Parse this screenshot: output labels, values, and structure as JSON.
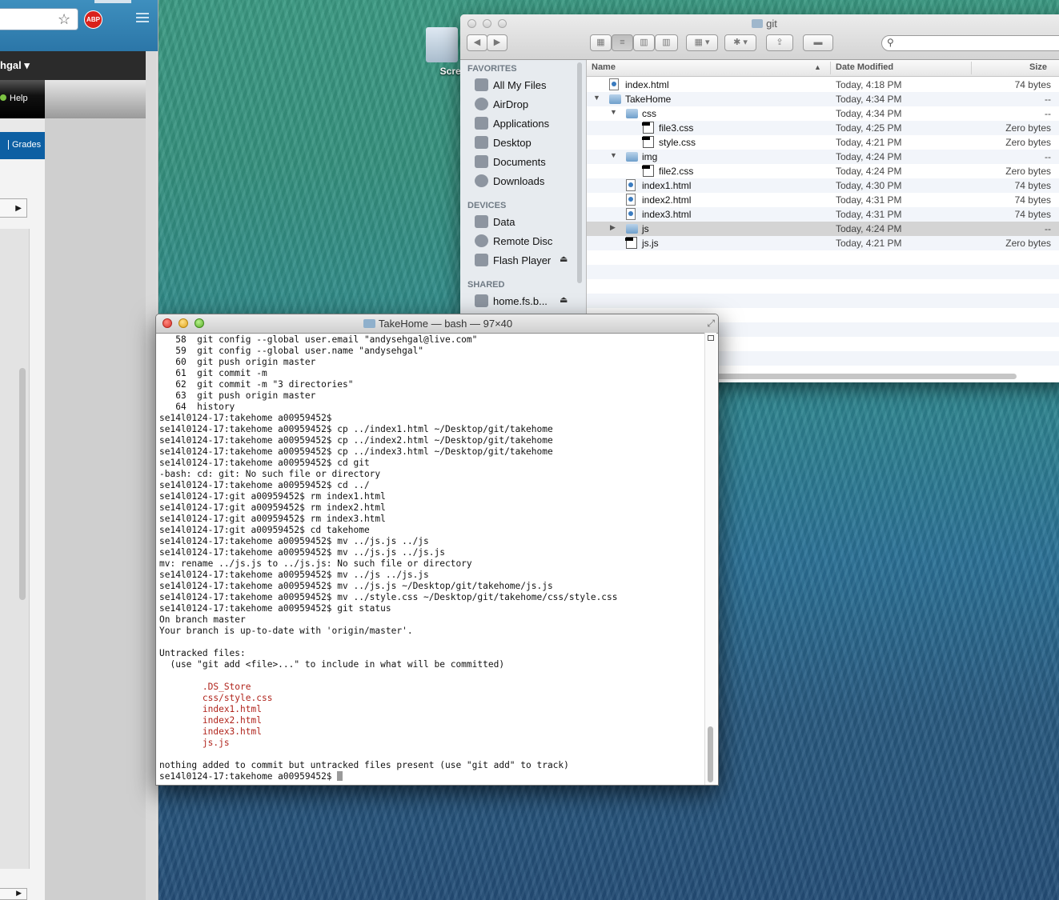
{
  "browser": {
    "user_label": "hgal ▾",
    "help_label": "Help",
    "nav_label": "Grades",
    "abp_label": "ABP",
    "arrow": "▶"
  },
  "desktop": {
    "icon_label": "Screens"
  },
  "finder": {
    "title": "git",
    "search_placeholder": "",
    "sidebar": {
      "favorites_header": "FAVORITES",
      "devices_header": "DEVICES",
      "shared_header": "SHARED",
      "favorites": [
        "All My Files",
        "AirDrop",
        "Applications",
        "Desktop",
        "Documents",
        "Downloads"
      ],
      "devices": [
        "Data",
        "Remote Disc",
        "Flash Player"
      ],
      "shared": [
        "home.fs.b..."
      ]
    },
    "columns": {
      "name": "Name",
      "date": "Date Modified",
      "size": "Size",
      "sort_arrow": "▲"
    },
    "rows": [
      {
        "name": "index.html",
        "date": "Today, 4:18 PM",
        "size": "74 bytes",
        "kind": "html",
        "depth": 0,
        "disc": ""
      },
      {
        "name": "TakeHome",
        "date": "Today, 4:34 PM",
        "size": "--",
        "kind": "folder",
        "depth": 0,
        "disc": "▼"
      },
      {
        "name": "css",
        "date": "Today, 4:34 PM",
        "size": "--",
        "kind": "folder",
        "depth": 1,
        "disc": "▼"
      },
      {
        "name": "file3.css",
        "date": "Today, 4:25 PM",
        "size": "Zero bytes",
        "kind": "css",
        "depth": 2,
        "disc": ""
      },
      {
        "name": "style.css",
        "date": "Today, 4:21 PM",
        "size": "Zero bytes",
        "kind": "css",
        "depth": 2,
        "disc": ""
      },
      {
        "name": "img",
        "date": "Today, 4:24 PM",
        "size": "--",
        "kind": "folder",
        "depth": 1,
        "disc": "▼"
      },
      {
        "name": "file2.css",
        "date": "Today, 4:24 PM",
        "size": "Zero bytes",
        "kind": "css",
        "depth": 2,
        "disc": ""
      },
      {
        "name": "index1.html",
        "date": "Today, 4:30 PM",
        "size": "74 bytes",
        "kind": "html",
        "depth": 1,
        "disc": ""
      },
      {
        "name": "index2.html",
        "date": "Today, 4:31 PM",
        "size": "74 bytes",
        "kind": "html",
        "depth": 1,
        "disc": ""
      },
      {
        "name": "index3.html",
        "date": "Today, 4:31 PM",
        "size": "74 bytes",
        "kind": "html",
        "depth": 1,
        "disc": ""
      },
      {
        "name": "js",
        "date": "Today, 4:24 PM",
        "size": "--",
        "kind": "folder",
        "depth": 1,
        "disc": "▶",
        "selected": true
      },
      {
        "name": "js.js",
        "date": "Today, 4:21 PM",
        "size": "Zero bytes",
        "kind": "css",
        "depth": 1,
        "disc": ""
      }
    ]
  },
  "terminal": {
    "title": "TakeHome — bash — 97×40",
    "lines": [
      {
        "text": "   58  git config --global user.email \"andysehgal@live.com\""
      },
      {
        "text": "   59  git config --global user.name \"andysehgal\""
      },
      {
        "text": "   60  git push origin master"
      },
      {
        "text": "   61  git commit -m"
      },
      {
        "text": "   62  git commit -m \"3 directories\""
      },
      {
        "text": "   63  git push origin master"
      },
      {
        "text": "   64  history"
      },
      {
        "text": "se14l0124-17:takehome a00959452$"
      },
      {
        "text": "se14l0124-17:takehome a00959452$ cp ../index1.html ~/Desktop/git/takehome"
      },
      {
        "text": "se14l0124-17:takehome a00959452$ cp ../index2.html ~/Desktop/git/takehome"
      },
      {
        "text": "se14l0124-17:takehome a00959452$ cp ../index3.html ~/Desktop/git/takehome"
      },
      {
        "text": "se14l0124-17:takehome a00959452$ cd git"
      },
      {
        "text": "-bash: cd: git: No such file or directory"
      },
      {
        "text": "se14l0124-17:takehome a00959452$ cd ../"
      },
      {
        "text": "se14l0124-17:git a00959452$ rm index1.html"
      },
      {
        "text": "se14l0124-17:git a00959452$ rm index2.html"
      },
      {
        "text": "se14l0124-17:git a00959452$ rm index3.html"
      },
      {
        "text": "se14l0124-17:git a00959452$ cd takehome"
      },
      {
        "text": "se14l0124-17:takehome a00959452$ mv ../js.js ../js"
      },
      {
        "text": "se14l0124-17:takehome a00959452$ mv ../js.js ../js.js"
      },
      {
        "text": "mv: rename ../js.js to ../js.js: No such file or directory"
      },
      {
        "text": "se14l0124-17:takehome a00959452$ mv ../js ../js.js"
      },
      {
        "text": "se14l0124-17:takehome a00959452$ mv ../js.js ~/Desktop/git/takehome/js.js"
      },
      {
        "text": "se14l0124-17:takehome a00959452$ mv ../style.css ~/Desktop/git/takehome/css/style.css"
      },
      {
        "text": "se14l0124-17:takehome a00959452$ git status"
      },
      {
        "text": "On branch master"
      },
      {
        "text": "Your branch is up-to-date with 'origin/master'."
      },
      {
        "text": ""
      },
      {
        "text": "Untracked files:"
      },
      {
        "text": "  (use \"git add <file>...\" to include in what will be committed)"
      },
      {
        "text": ""
      },
      {
        "text": "        .DS_Store",
        "red": true
      },
      {
        "text": "        css/style.css",
        "red": true
      },
      {
        "text": "        index1.html",
        "red": true
      },
      {
        "text": "        index2.html",
        "red": true
      },
      {
        "text": "        index3.html",
        "red": true
      },
      {
        "text": "        js.js",
        "red": true
      },
      {
        "text": ""
      },
      {
        "text": "nothing added to commit but untracked files present (use \"git add\" to track)"
      },
      {
        "text": "se14l0124-17:takehome a00959452$ ",
        "cursor": true
      }
    ]
  },
  "colors": {
    "untracked_red": "#b0241c",
    "selected_row": "#d4d4d4"
  }
}
